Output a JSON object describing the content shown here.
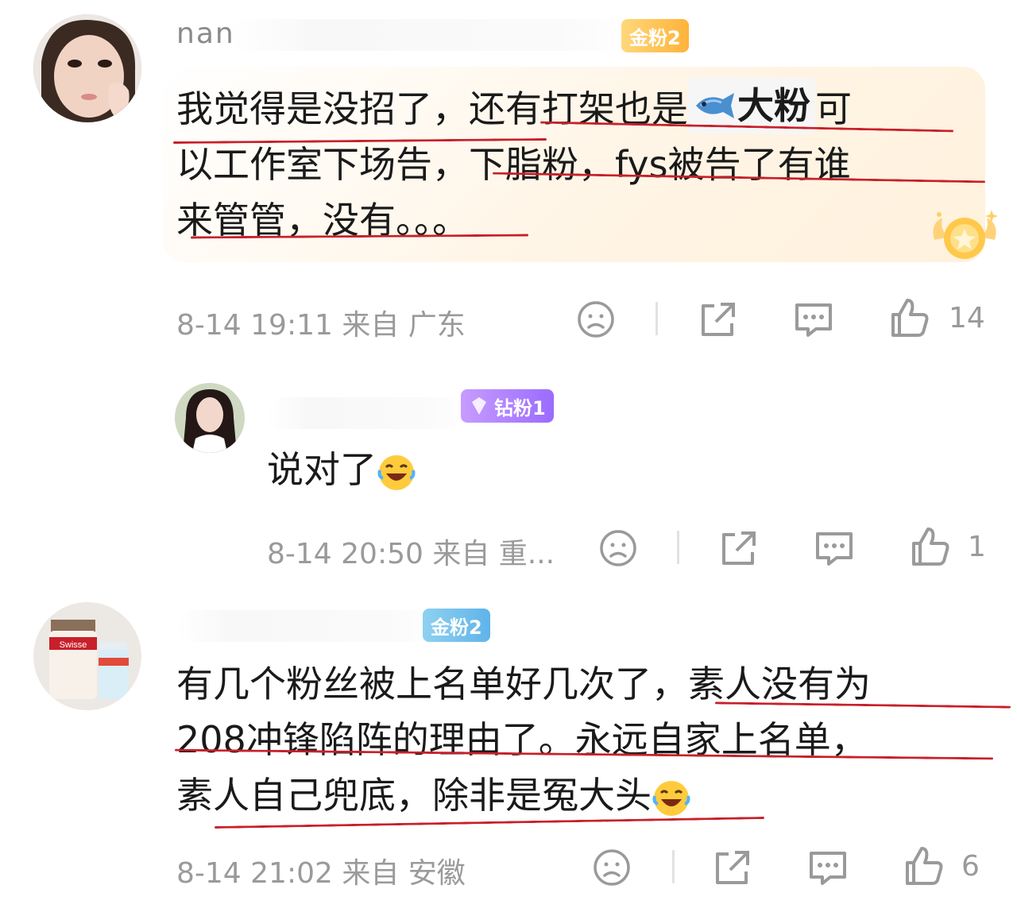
{
  "comments": [
    {
      "username_fragment": "nan",
      "badge": "金粉2",
      "text_line1_a": "我觉得是没招了，还有打架也是",
      "fan_chip_label": "大粉",
      "text_line1_b": "可",
      "text_line2": "以工作室下场告，下脂粉，fys被告了有谁",
      "text_line3": "来管管，没有。。。",
      "meta": "8-14 19:11  来自 广东",
      "like_count": "14"
    },
    {
      "username_fragment": "",
      "badge": "钻粉1",
      "text": "说对了",
      "meta": "8-14 20:50  来自 重...",
      "like_count": "1"
    },
    {
      "username_fragment": "",
      "badge": "金粉2",
      "text_line1": "有几个粉丝被上名单好几次了，素人没有为",
      "text_line2": "208冲锋陷阵的理由了。永远自家上名单，",
      "text_line3": "素人自己兜底，除非是冤大头",
      "meta": "8-14 21:02  来自 安徽",
      "like_count": "6"
    }
  ],
  "avatar3_label": "Swisse",
  "colors": {
    "underline": "#c8202a",
    "meta": "#9a9a9a",
    "gold_badge": "#ffb33a",
    "diamond_badge": "#9b6bff"
  },
  "icons": [
    "sad-face-icon",
    "share-icon",
    "comment-icon",
    "thumbs-up-icon",
    "laughing-emoji-icon",
    "fish-icon",
    "crown-badge-icon"
  ]
}
